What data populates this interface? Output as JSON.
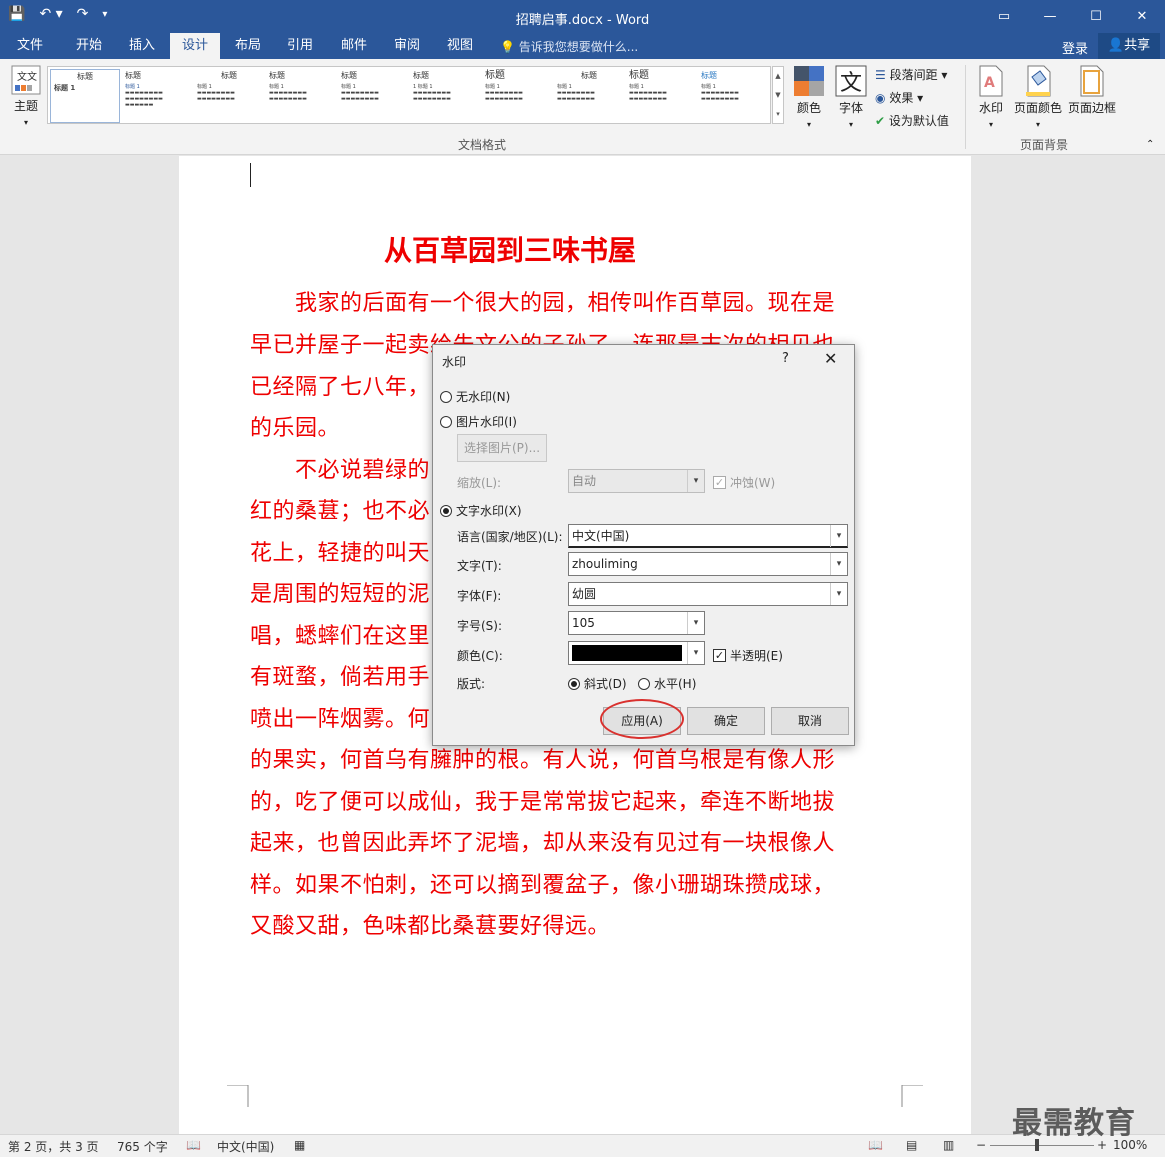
{
  "titlebar": {
    "title": "招聘启事.docx - Word"
  },
  "tabs": [
    {
      "label": "文件"
    },
    {
      "label": "开始"
    },
    {
      "label": "插入"
    },
    {
      "label": "设计"
    },
    {
      "label": "布局"
    },
    {
      "label": "引用"
    },
    {
      "label": "邮件"
    },
    {
      "label": "审阅"
    },
    {
      "label": "视图"
    }
  ],
  "tellme": "告诉我您想要做什么...",
  "account": {
    "login": "登录",
    "share": "共享"
  },
  "ribbon": {
    "theme": "主题",
    "gallery": [
      {
        "title": "标题",
        "sub": "标题 1"
      },
      {
        "title": "标题",
        "sub": "标题 1"
      },
      {
        "title": "标题",
        "sub": "标题 1"
      },
      {
        "title": "标题",
        "sub": "标题 1"
      },
      {
        "title": "标题",
        "sub": "标题 1"
      },
      {
        "title": "标题",
        "sub": "1 标题 1"
      },
      {
        "title": "标题",
        "sub": "标题 1"
      },
      {
        "title": "标题",
        "sub": "标题 1"
      },
      {
        "title": "标题",
        "sub": "标题 1"
      },
      {
        "title": "标题",
        "sub": "标题 1"
      }
    ],
    "colors": "颜色",
    "fonts": "字体",
    "paragraph_spacing": "段落间距",
    "effects": "效果",
    "set_default": "设为默认值",
    "group_document_format": "文档格式",
    "watermark": "水印",
    "page_color": "页面颜色",
    "page_border": "页面边框",
    "group_page_background": "页面背景"
  },
  "document": {
    "title": "从百草园到三味书屋",
    "lines": [
      "　　我家的后面有一个很大的园，相传叫作百草园。现在是",
      "早已并屋子一起卖给朱文公的子孙了，连那最末次的相见也",
      "已经隔了七八年，　　　　　　　　　　　　　　　　　是我",
      "的乐园。",
      "　　不必说碧绿的　　　　　　　　　　　　　　　　　紫",
      "红的桑葚；也不必　　　　　　　　　　　　　　　　　菜",
      "花上，轻捷的叫天　　　　　　　　　　　　　　　　　单",
      "是周围的短短的泥　　　　　　　　　　　　　　　　　低",
      "唱，蟋蟀们在这里　　　　　　　　　　　　　　　　　还",
      "有斑蝥，倘若用手　　　　　　　　　　　　　　　　　窍",
      "喷出一阵烟雾。何　　　　　　　　　　　　　　　　　般",
      "的果实，何首乌有臃肿的根。有人说，何首乌根是有像人形",
      "的，吃了便可以成仙，我于是常常拔它起来，牵连不断地拔",
      "起来，也曾因此弄坏了泥墙，却从来没有见过有一块根像人",
      "样。如果不怕刺，还可以摘到覆盆子，像小珊瑚珠攒成球，",
      "又酸又甜，色味都比桑葚要好得远。"
    ]
  },
  "dialog": {
    "title": "水印",
    "help": "?",
    "close": "✕",
    "no_watermark": "无水印(N)",
    "picture_watermark": "图片水印(I)",
    "select_picture": "选择图片(P)...",
    "scale_label": "缩放(L):",
    "scale_value": "自动",
    "washout": "冲蚀(W)",
    "text_watermark": "文字水印(X)",
    "language_label": "语言(国家/地区)(L):",
    "language_value": "中文(中国)",
    "text_label": "文字(T):",
    "text_value": "zhouliming",
    "font_label": "字体(F):",
    "font_value": "幼圆",
    "size_label": "字号(S):",
    "size_value": "105",
    "color_label": "颜色(C):",
    "color_value": "#000000",
    "semitransparent": "半透明(E)",
    "layout_label": "版式:",
    "diagonal": "斜式(D)",
    "horizontal": "水平(H)",
    "apply": "应用(A)",
    "ok": "确定",
    "cancel": "取消"
  },
  "status": {
    "page": "第 2 页，共 3 页",
    "words": "765 个字",
    "language": "中文(中国)",
    "zoom": "100%"
  },
  "brand": "最需教育",
  "colors": {
    "accent": "#2b579a",
    "doc_text": "#ee0000",
    "highlight": "#d9312e"
  }
}
